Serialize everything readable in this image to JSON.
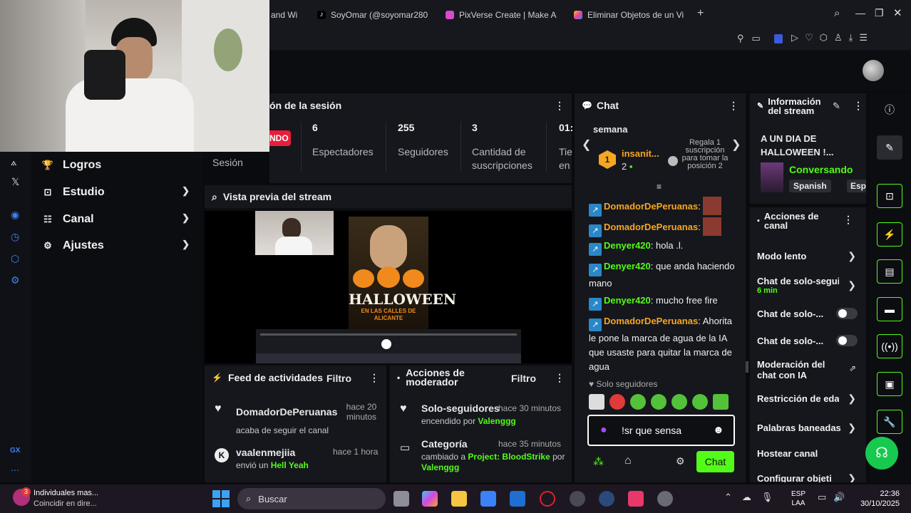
{
  "browser": {
    "tabs": [
      {
        "label": "and Wi",
        "color": "#3a3b42"
      },
      {
        "label": "SoyOmar (@soyomar280",
        "color": "#111111"
      },
      {
        "label": "PixVerse Create | Make A",
        "color": "#d64bd0"
      },
      {
        "label": "Eliminar Objetos de un Vi",
        "color": "#f4c430"
      }
    ],
    "new_tab": "+"
  },
  "nav": {
    "items": [
      {
        "label": "Logros",
        "icon": "trophy-icon"
      },
      {
        "label": "Estudio",
        "icon": "studio-icon"
      },
      {
        "label": "Canal",
        "icon": "channel-icon"
      },
      {
        "label": "Ajustes",
        "icon": "gear-icon"
      }
    ],
    "bottom_label": "GX"
  },
  "session": {
    "title": "ón de la sesión",
    "live_badge": "NDO",
    "sesion_label": "Sesión",
    "stats": [
      {
        "value": "6",
        "label": "Espectadores"
      },
      {
        "value": "255",
        "label": "Seguidores"
      },
      {
        "value": "3",
        "label": "Cantidad de suscripciones"
      },
      {
        "value": "01:",
        "label": "Tie en"
      }
    ]
  },
  "preview": {
    "title": "Vista previa del stream",
    "poster_title": "HALLOWEEN",
    "poster_sub": "EN LAS CALLES DE ALICANTE"
  },
  "feed": {
    "title": "Feed de actividades",
    "filter": "Filtro",
    "items": [
      {
        "user": "DomadorDePeruanas",
        "time": "hace 20 minutos",
        "action": "acaba de seguir el canal"
      },
      {
        "user": "vaalenmejiia",
        "time": "hace 1 hora",
        "action_prefix": "envió un",
        "action_highlight": "Hell Yeah"
      }
    ]
  },
  "mod": {
    "title": "Acciones de moderador",
    "filter": "Filtro",
    "items": [
      {
        "title": "Solo-seguidores",
        "time": "hace 30 minutos",
        "sub_prefix": "encendido por",
        "sub_user": "Valenggg"
      },
      {
        "title": "Categoría",
        "time": "hace 35 minutos",
        "sub_prefix": "cambiado a",
        "sub_project": "Project: BloodStrike",
        "sub_mid": "por",
        "sub_user": "Valenggg"
      }
    ]
  },
  "chat": {
    "title": "Chat",
    "week_label": "semana",
    "leader_rank": "1",
    "leader_name": "insanit...",
    "leader_count": "2",
    "gift_text": "Regala 1 suscripción para tomar la posición 2",
    "messages": [
      {
        "user": "DomadorDePeruanas",
        "color": "orange",
        "text": "",
        "emote": true
      },
      {
        "user": "DomadorDePeruanas",
        "color": "orange",
        "text": "",
        "emote": true
      },
      {
        "user": "Denyer420",
        "color": "green",
        "text": "hola .l."
      },
      {
        "user": "Denyer420",
        "color": "green",
        "text": "que anda haciendo mano"
      },
      {
        "user": "Denyer420",
        "color": "green",
        "text": "mucho free fire"
      },
      {
        "user": "DomadorDePeruanas",
        "color": "orange",
        "text": "Ahorita le pone la marca de agua de la IA que usaste para quitar la marca de agua"
      }
    ],
    "followers_only": "Solo seguidores",
    "input_value": "!sr que sensa",
    "send_label": "Chat"
  },
  "info": {
    "title": "Información del stream",
    "stream_title": "A UN DIA DE HALLOWEEN !...",
    "category": "Conversando",
    "tags": [
      "Spanish",
      "Esp"
    ]
  },
  "channel_actions": {
    "title": "Acciones de canal",
    "rows": [
      {
        "label": "Modo lento",
        "control": "chevron"
      },
      {
        "label": "Chat de solo-segui",
        "sub": "6 min",
        "control": "chevron"
      },
      {
        "label": "Chat de solo-...",
        "control": "toggle"
      },
      {
        "label": "Chat de solo-...",
        "control": "toggle"
      },
      {
        "label": "Moderación del chat con IA",
        "control": "external"
      },
      {
        "label": "Restricción de edad",
        "control": "chevron"
      },
      {
        "label": "Palabras baneadas",
        "control": "chevron"
      },
      {
        "label": "Hostear canal",
        "control": "none"
      },
      {
        "label": "Configurar objeti",
        "control": "chevron"
      }
    ]
  },
  "taskbar": {
    "weather_title": "Individuales mas...",
    "weather_sub": "Coincidir en dire...",
    "weather_badge": "3",
    "search_placeholder": "Buscar",
    "lang_top": "ESP",
    "lang_bottom": "LAA",
    "time": "22:36",
    "date": "30/10/2025"
  },
  "colors": {
    "accent": "#53fc18",
    "live": "#e91e3c",
    "username_orange": "#f5a623"
  }
}
